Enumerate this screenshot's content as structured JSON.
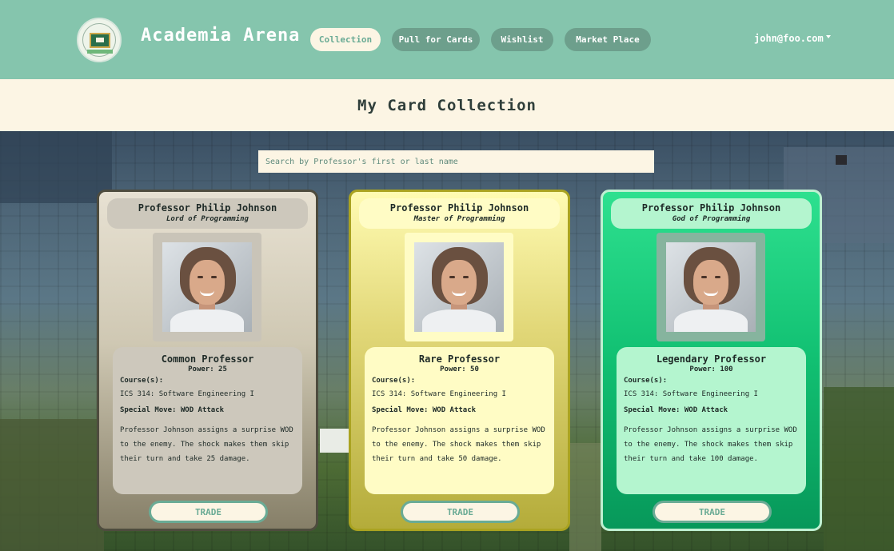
{
  "nav": {
    "brand": "Academia Arena",
    "links": [
      "Collection",
      "Pull for Cards",
      "Wishlist",
      "Market Place"
    ],
    "user": "john@foo.com"
  },
  "page": {
    "title": "My Card Collection"
  },
  "search": {
    "placeholder": "Search by Professor's first or last name"
  },
  "colors": {
    "nav_bg": "#85c5ad",
    "cream": "#fcf5e4",
    "common": "#cdc8bc",
    "rare": "#fffcc5",
    "legendary": "#b4f5cf"
  },
  "cards": [
    {
      "name": "Professor Philip Johnson",
      "title": "Lord of Programming",
      "rarity": "Common Professor",
      "power": "Power: 25",
      "courses_label": "Course(s):",
      "course": "ICS 314: Software Engineering I",
      "special_move": "Special Move: WOD Attack",
      "description": "Professor Johnson assigns a surprise WOD to the enemy. The shock makes them skip their turn and take 25 damage.",
      "trade_label": "TRADE"
    },
    {
      "name": "Professor Philip Johnson",
      "title": "Master of Programming",
      "rarity": "Rare Professor",
      "power": "Power: 50",
      "courses_label": "Course(s):",
      "course": "ICS 314: Software Engineering I",
      "special_move": "Special Move: WOD Attack",
      "description": "Professor Johnson assigns a surprise WOD to the enemy. The shock makes them skip their turn and take 50 damage.",
      "trade_label": "TRADE"
    },
    {
      "name": "Professor Philip Johnson",
      "title": "God of Programming",
      "rarity": "Legendary Professor",
      "power": "Power: 100",
      "courses_label": "Course(s):",
      "course": "ICS 314: Software Engineering I",
      "special_move": "Special Move: WOD Attack",
      "description": "Professor Johnson assigns a surprise WOD to the enemy. The shock makes them skip their turn and take 100 damage.",
      "trade_label": "TRADE"
    }
  ]
}
